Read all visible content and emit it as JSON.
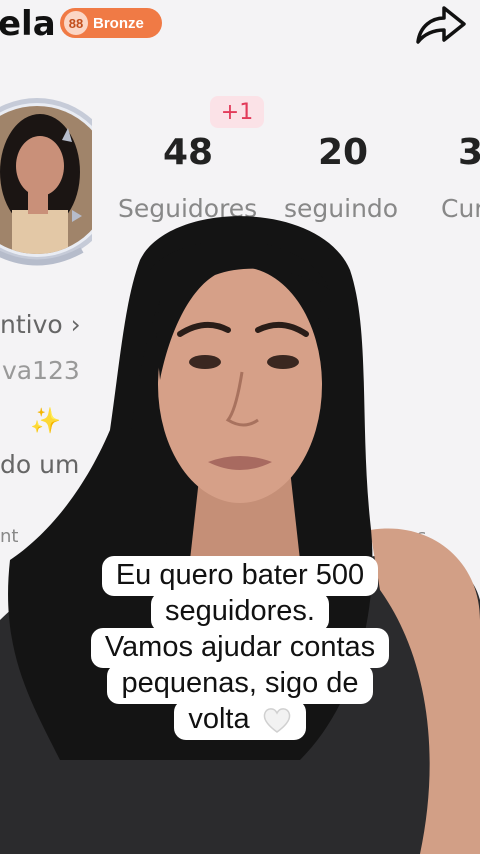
{
  "profile": {
    "username_partial": "ela",
    "badge_label": "Bronze",
    "new_followers": "+1",
    "stats": [
      {
        "value": "48",
        "label": "Seguidores"
      },
      {
        "value": "20",
        "label": "seguindo"
      },
      {
        "value": "3",
        "label": "Cur"
      }
    ],
    "incentive_link": "ntivo ›",
    "handle_partial": "va123",
    "handle_right_partial": "r",
    "emojis": "✨",
    "bio_partial": "do um",
    "tab_left_partial": "nt",
    "tab_right_partial": "Compras"
  },
  "caption": {
    "lines": [
      "Eu quero bater 500",
      "seguidores.",
      "Vamos ajudar contas",
      "pequenas, sigo de",
      "volta"
    ]
  },
  "colors": {
    "badge": "#f07a45",
    "plus_bg": "#fbe2e7",
    "plus_text": "#e23b5a",
    "hair": "#141414",
    "skin": "#d6a088"
  },
  "icons": [
    "share-icon",
    "badge-icon",
    "white-heart-icon"
  ]
}
